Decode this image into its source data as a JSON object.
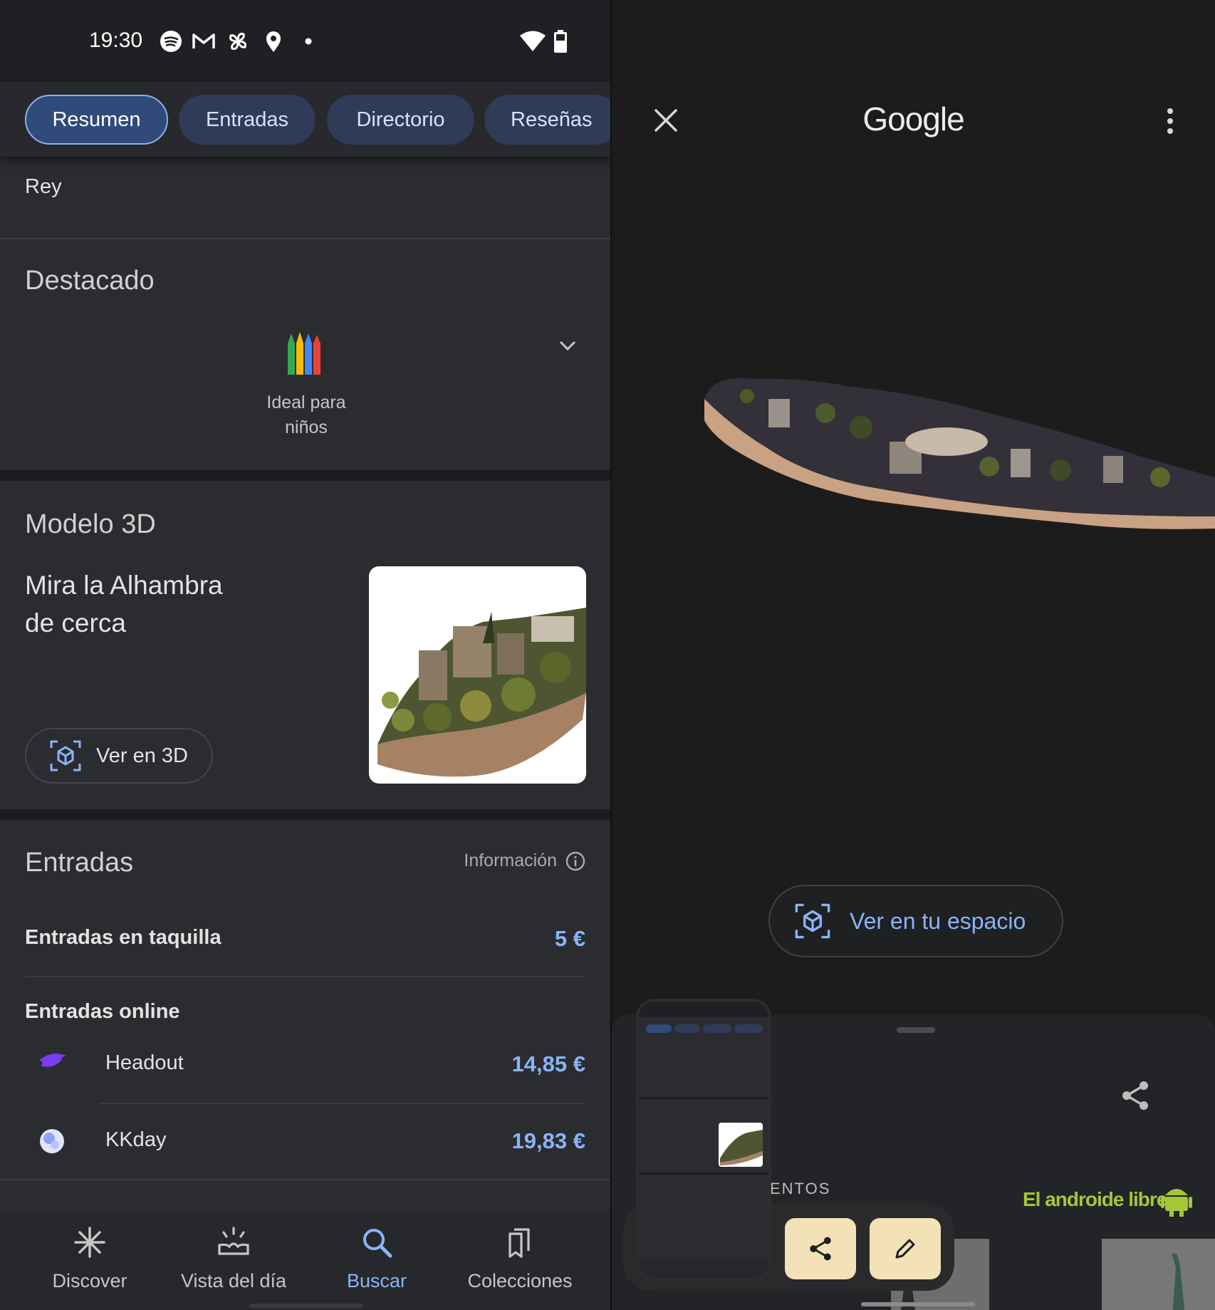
{
  "status_bar": {
    "time": "19:30"
  },
  "tabs": [
    {
      "label": "Resumen",
      "active": true
    },
    {
      "label": "Entradas",
      "active": false
    },
    {
      "label": "Directorio",
      "active": false
    },
    {
      "label": "Reseñas",
      "active": false
    }
  ],
  "dropdown": {
    "value": "Rey"
  },
  "destacado": {
    "heading": "Destacado",
    "badge_line1": "Ideal para",
    "badge_line2": "niños",
    "badge_icon": "crayons-icon"
  },
  "modelo3d": {
    "heading": "Modelo 3D",
    "line1": "Mira la Alhambra",
    "line2": "de cerca",
    "button_label": "Ver en 3D"
  },
  "entradas": {
    "heading": "Entradas",
    "info_label": "Información",
    "taquilla_label": "Entradas en taquilla",
    "taquilla_price": "5 €",
    "online_heading": "Entradas online",
    "providers": [
      {
        "name": "Headout",
        "price": "14,85 €",
        "icon": "headout-logo"
      },
      {
        "name": "KKday",
        "price": "19,83 €",
        "icon": "kkday-logo"
      }
    ]
  },
  "bottom_nav": [
    {
      "label": "Discover",
      "icon": "asterisk-icon",
      "active": false
    },
    {
      "label": "Vista del día",
      "icon": "sunrise-icon",
      "active": false
    },
    {
      "label": "Buscar",
      "icon": "search-icon",
      "active": true
    },
    {
      "label": "Colecciones",
      "icon": "bookmarks-icon",
      "active": false
    }
  ],
  "viewer": {
    "logo": "Google",
    "ar_button_label": "Ver en tu espacio",
    "section_partial": "ENTOS"
  },
  "watermark": "El androide libre",
  "colors": {
    "accent": "#8ab4f8",
    "chip_bg": "#2f3b57",
    "panel_bg": "#2b2c30",
    "tray_button": "#f3e2b8",
    "watermark": "#a4c639"
  }
}
